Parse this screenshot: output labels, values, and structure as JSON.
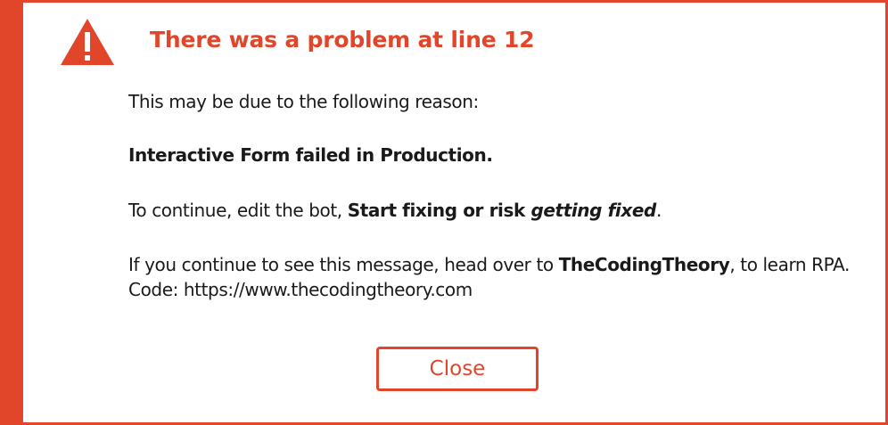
{
  "dialog": {
    "title": "There was a problem at line 12",
    "icon": "warning-triangle-icon",
    "reason_intro": "This may be due to the following reason:",
    "error_message": "Interactive Form failed in Production.",
    "continue_prefix": "To continue, edit the bot, ",
    "continue_strong": "Start fixing or risk ",
    "continue_italic": "getting fixed",
    "continue_suffix": ".",
    "help_prefix": "If you continue to see this message, head over to ",
    "help_link": "TheCodingTheory",
    "help_suffix": ", to learn RPA.",
    "code_line": "Code: https://www.thecodingtheory.com",
    "close_label": "Close"
  },
  "colors": {
    "accent": "#e2462a",
    "text": "#1a1a1a",
    "background": "#ffffff"
  }
}
